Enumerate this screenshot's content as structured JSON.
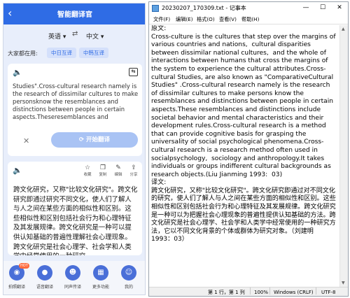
{
  "phone": {
    "header": {
      "back_icon": "back-arrow-icon",
      "title": "智能翻译官"
    },
    "languages": {
      "source": "英语 ▾",
      "target": "中文 ▾"
    },
    "recent": {
      "label": "大家都在用:",
      "chips": [
        "中日互译",
        "中韩互译"
      ]
    },
    "input_card": {
      "source_text": "Studies\".Cross-cultural research namely is the research of dissimilar cultures to make personsknow the resemblances and distinctions between people in certain aspects.Theseresemblances and",
      "translate_button": "开始翻译"
    },
    "output_card": {
      "actions": [
        {
          "icon": "star-icon",
          "label": "收藏"
        },
        {
          "icon": "copy-icon",
          "label": "复制"
        },
        {
          "icon": "edit-icon",
          "label": "编辑"
        },
        {
          "icon": "share-icon",
          "label": "分享"
        }
      ],
      "translated_text": "跨文化研究，又称\"比较文化研究\"。跨文化研究即通过研究不同文化，使人们了解人与人之间在某些方面的相似性和区别。这些相似性和区别包括社会行为和心理特征及其发展规律。跨文化研究是一种可以提供认知基础的普遍性理解社会心理现象。跨文化研究是社会心理学、社会学和人类学中经常使用的一种研究"
    },
    "nav": [
      {
        "label": "拍照翻译",
        "icon": "camera-icon",
        "badge": "HOT"
      },
      {
        "label": "语音翻译",
        "icon": "microphone-icon"
      },
      {
        "label": "同声传译",
        "icon": "simultaneous-icon"
      },
      {
        "label": "更多功能",
        "icon": "grid-icon"
      },
      {
        "label": "我的",
        "icon": "user-icon"
      }
    ]
  },
  "notepad": {
    "title": "20230207_170309.txt - 记事本",
    "window_buttons": [
      "—",
      "☐",
      "✕"
    ],
    "menu": [
      "文件(F)",
      "编辑(E)",
      "格式(O)",
      "查看(V)",
      "帮助(H)"
    ],
    "content": "原文:\nCross-culture is the cultures that step over the margins of various countries and nations,  cultural disparities between dissimilar national cultures,  and the whole of interactions between humans that cross the margins of the system to experience the cultural attributes.Cross-cultural Studies, are also known as \"ComparativeCultural Studies\" .Cross-cultural research namely is the research of dissimilar cultures to make persons know the resemblances and distinctions between people in certain aspects.These resemblances and distinctions include societal behavior and mental characteristics and their development rules.Cross-cultural research is a method that can provide cognitive basis for grasping the universality of social psychological phenomena.Cross-cultural research is a research method often used in socialpsychology,  sociology and anthropology.It takes individuals or groups indifferent cultural backgrounds as research objects.(Liu Jianming 1993:  03)\n译文:\n跨文化研究，又称\"比较文化研究\"。跨文化研究即通过对不同文化的研究，使人们了解人与人之间在某些方面的相似性和区别。这些相似性和区别包括社会行为和心理特征及其发展规律。跨文化研究是一种可以为把握社会心理现象的普遍性提供认知基础的方法。跨文化研究是社会心理学、社会学和人类学中经常使用的一种研究方法，它以不同文化背景的个体或群体为研究对象。（刘建明 1993：03）",
    "status": {
      "position": "第 1 行，第 1 列",
      "zoom": "100%",
      "eol": "Windows (CRLF)",
      "encoding": "UTF-8"
    }
  }
}
